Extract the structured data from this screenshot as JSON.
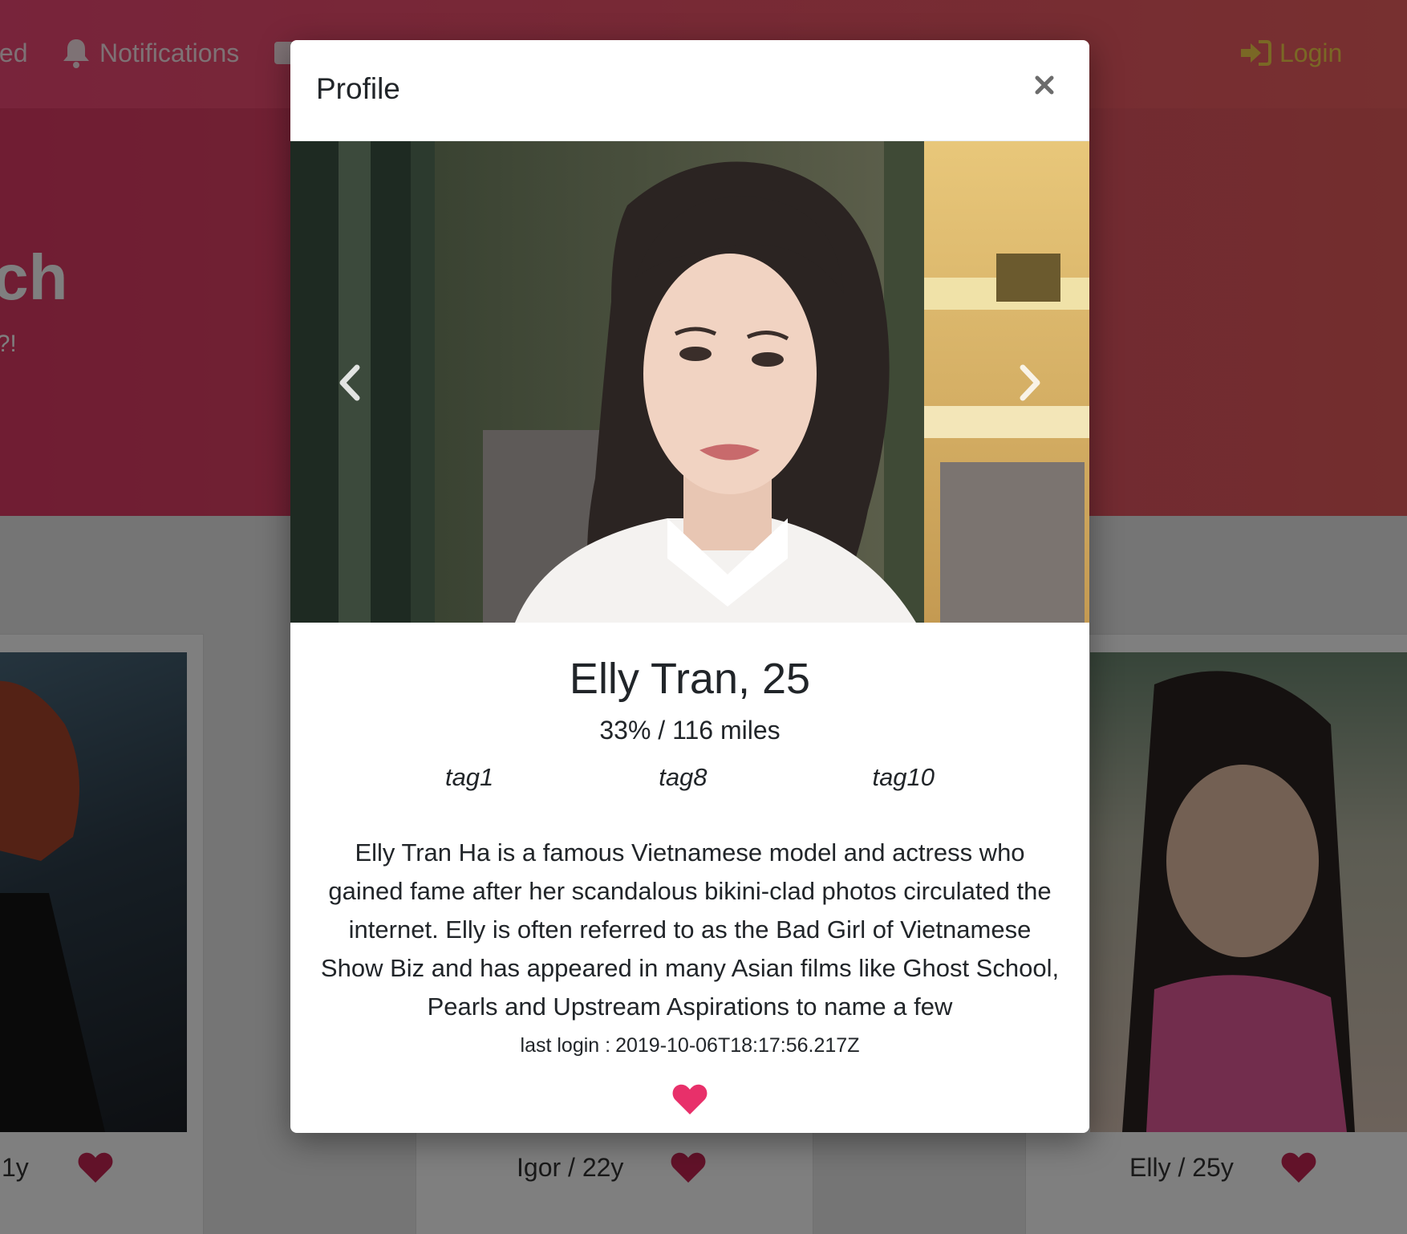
{
  "navbar": {
    "connected_label": "ted",
    "notifications_label": "Notifications",
    "login_label": "Login"
  },
  "hero": {
    "title": "atch",
    "subtitle": "Fun?!"
  },
  "cards": [
    {
      "label": "1y"
    },
    {
      "label": "Igor / 22y"
    },
    {
      "label": "Elly / 25y"
    }
  ],
  "modal": {
    "title": "Profile",
    "close_glyph": "×",
    "profile": {
      "name_age": "Elly Tran, 25",
      "stats": "33% / 116 miles",
      "tags": [
        "tag1",
        "tag8",
        "tag10"
      ],
      "bio": "Elly Tran Ha is a famous Vietnamese model and actress who gained fame after her scandalous bikini-clad photos circulated the internet. Elly is often referred to as the Bad Girl of Vietnamese Show Biz and has appeared in many Asian films like Ghost School, Pearls and Upstream Aspirations to name a few",
      "last_login_label": "last login :",
      "last_login_value": "2019-10-06T18:17:56.217Z"
    }
  },
  "colors": {
    "accent_heart": "#e8306a",
    "card_heart": "#e8306a",
    "login": "#f5d04a",
    "navbar_start": "#f04876",
    "navbar_end": "#ef6060"
  },
  "icons": {
    "notifications": "bell-icon",
    "profile_nav": "user-card-icon",
    "login": "sign-in-icon",
    "close": "close-icon",
    "prev": "chevron-left-icon",
    "next": "chevron-right-icon",
    "like": "heart-icon"
  }
}
